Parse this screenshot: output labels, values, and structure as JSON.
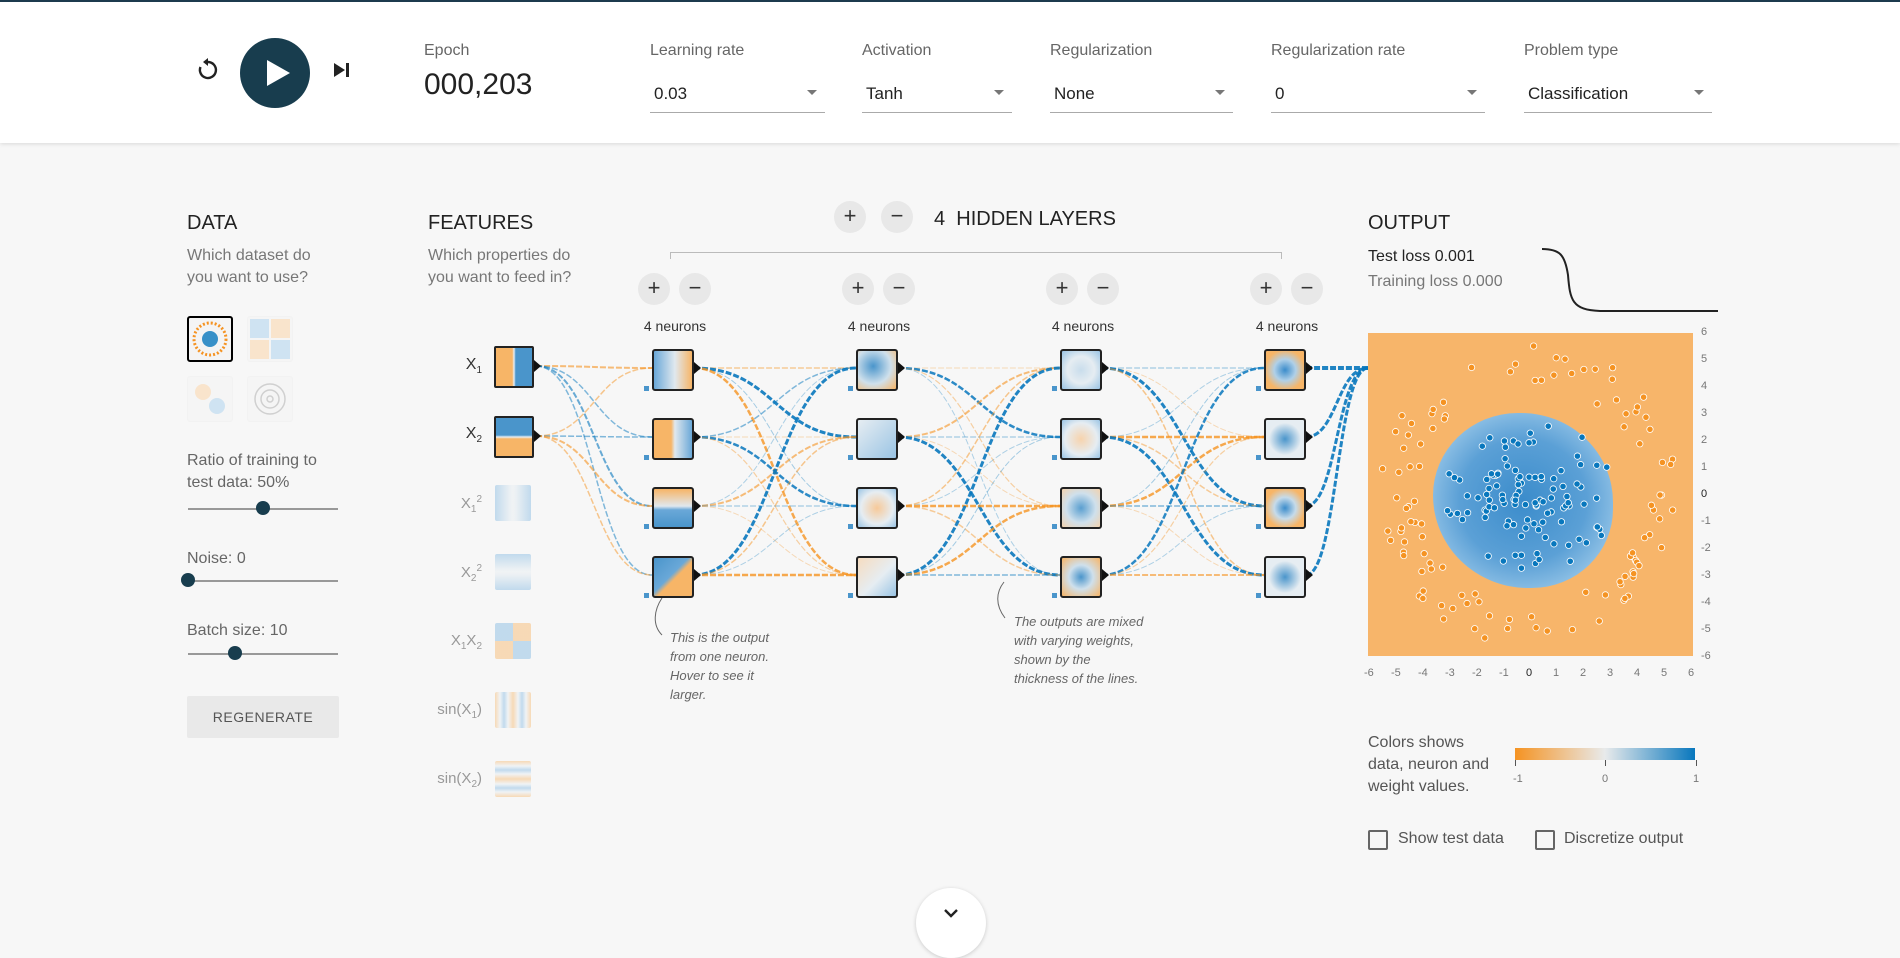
{
  "controls": {
    "reset_icon": "reset-icon",
    "play_icon": "play-icon",
    "step_icon": "step-icon"
  },
  "epoch": {
    "label": "Epoch",
    "value": "000,203"
  },
  "learning_rate": {
    "label": "Learning rate",
    "value": "0.03"
  },
  "activation": {
    "label": "Activation",
    "value": "Tanh"
  },
  "regularization": {
    "label": "Regularization",
    "value": "None"
  },
  "regularization_rate": {
    "label": "Regularization rate",
    "value": "0"
  },
  "problem_type": {
    "label": "Problem type",
    "value": "Classification"
  },
  "data": {
    "heading": "DATA",
    "question": "Which dataset do you want to use?",
    "ratio_label": "Ratio of training to test data:",
    "ratio_value": "50%",
    "ratio_fraction": 0.5,
    "noise_label": "Noise:",
    "noise_value": "0",
    "noise_fraction": 0.0,
    "batch_label": "Batch size:",
    "batch_value": "10",
    "batch_fraction": 0.31,
    "regenerate": "REGENERATE"
  },
  "features": {
    "heading": "FEATURES",
    "question": "Which properties do you want to feed in?",
    "items": [
      {
        "label": "X",
        "sub": "1",
        "sup": "",
        "active": true
      },
      {
        "label": "X",
        "sub": "2",
        "sup": "",
        "active": true
      },
      {
        "label": "X",
        "sub": "1",
        "sup": "2",
        "active": false
      },
      {
        "label": "X",
        "sub": "2",
        "sup": "2",
        "active": false
      },
      {
        "label": "X",
        "sub": "1",
        "sup": "",
        "label2": "X",
        "sub2": "2",
        "active": false
      },
      {
        "label": "sin(X",
        "sub": "1",
        "tail": ")",
        "active": false
      },
      {
        "label": "sin(X",
        "sub": "2",
        "tail": ")",
        "active": false
      }
    ]
  },
  "hidden": {
    "count": "4",
    "title": "HIDDEN LAYERS",
    "layers": [
      {
        "neurons": "4 neurons"
      },
      {
        "neurons": "4 neurons"
      },
      {
        "neurons": "4 neurons"
      },
      {
        "neurons": "4 neurons"
      }
    ],
    "note1": "This is the output from one neuron. Hover to see it larger.",
    "note2": "The outputs are mixed with varying weights, shown by the thickness of the lines."
  },
  "output": {
    "heading": "OUTPUT",
    "test_loss_label": "Test loss",
    "test_loss_value": "0.001",
    "train_loss_label": "Training loss",
    "train_loss_value": "0.000",
    "colors_text": "Colors shows data, neuron and weight values.",
    "legend_min": "-1",
    "legend_mid": "0",
    "legend_max": "1",
    "show_test": "Show test data",
    "discretize": "Discretize output",
    "axis_ticks_x": [
      "-6",
      "-5",
      "-4",
      "-3",
      "-2",
      "-1",
      "0",
      "1",
      "2",
      "3",
      "4",
      "5",
      "6"
    ],
    "axis_ticks_y": [
      "6",
      "5",
      "4",
      "3",
      "2",
      "1",
      "0",
      "-1",
      "-2",
      "-3",
      "-4",
      "-5",
      "-6"
    ]
  },
  "colors": {
    "orange": "#f59322",
    "blue": "#0877bd",
    "dark": "#183d4e"
  }
}
